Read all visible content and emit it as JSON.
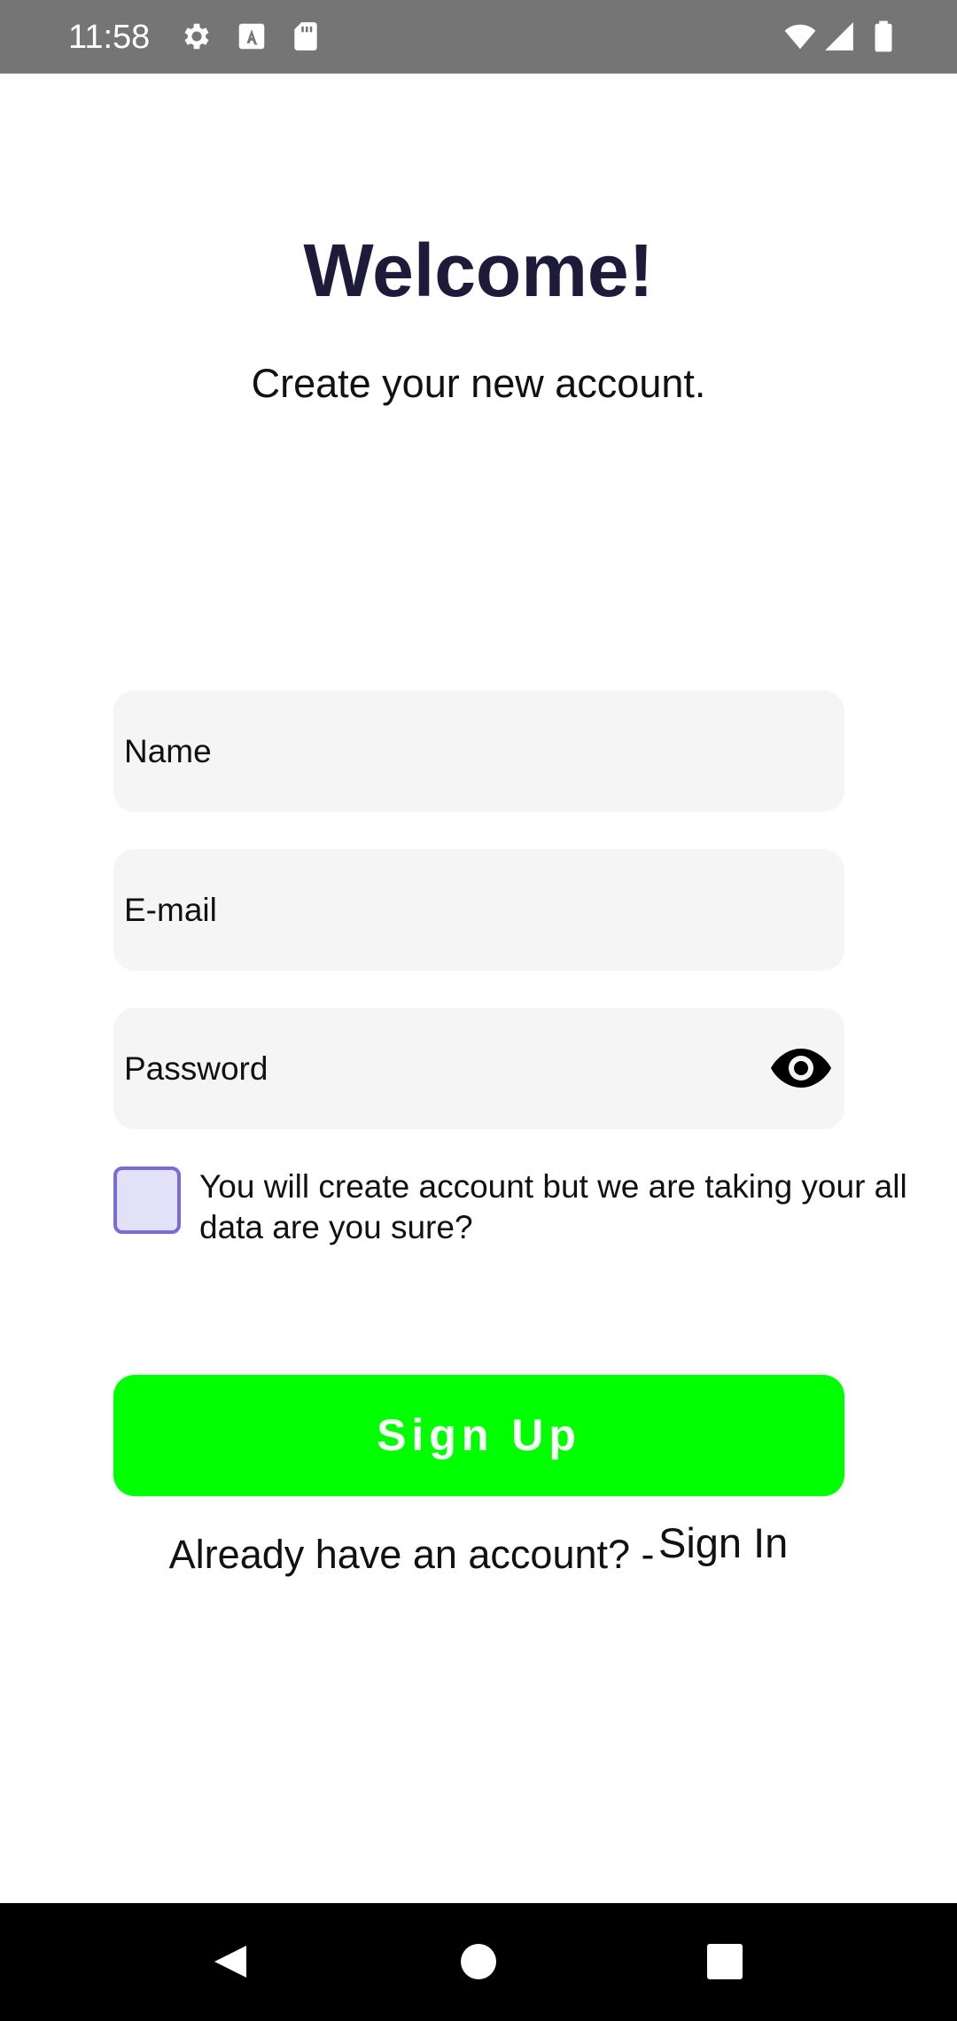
{
  "status_bar": {
    "time": "11:58",
    "left_icons": [
      "gear-icon",
      "keyboard-a-icon",
      "sd-card-icon"
    ],
    "right_icons": [
      "wifi-icon",
      "signal-icon",
      "battery-icon"
    ],
    "background": "#757575"
  },
  "header": {
    "title": "Welcome!",
    "subtitle": "Create your new account."
  },
  "form": {
    "name_placeholder": "Name",
    "email_placeholder": "E-mail",
    "password_placeholder": "Password",
    "password_toggle_icon": "eye-icon",
    "consent_text": "You will create account but we are taking your all data are you sure?",
    "consent_checked": false,
    "signup_label": "Sign Up"
  },
  "footer": {
    "signin_prompt": "Already have an account? -",
    "signin_link": "Sign In"
  },
  "colors": {
    "title": "#1e1b3a",
    "field_background": "#f5f5f5",
    "checkbox_border": "#7b6bd6",
    "checkbox_fill": "#e3e1f7",
    "signup_button": "#00ff00"
  },
  "nav_bar": {
    "buttons": [
      "back-icon",
      "home-icon",
      "recents-icon"
    ]
  }
}
